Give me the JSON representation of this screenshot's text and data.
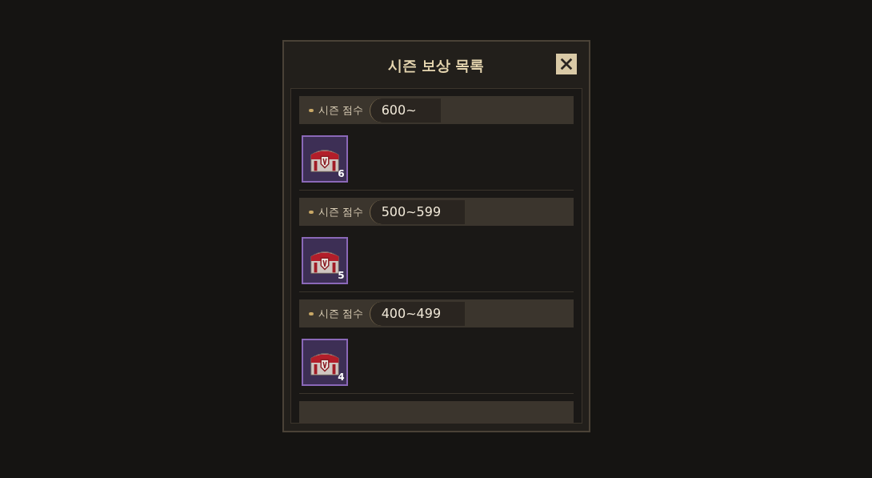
{
  "dialog": {
    "title": "시즌 보상 목록"
  },
  "tiers": [
    {
      "label": "시즌 점수",
      "range": "600~",
      "rewards": [
        {
          "count": "6"
        }
      ]
    },
    {
      "label": "시즌 점수",
      "range": "500~599",
      "rewards": [
        {
          "count": "5"
        }
      ]
    },
    {
      "label": "시즌 점수",
      "range": "400~499",
      "rewards": [
        {
          "count": "4"
        }
      ]
    }
  ]
}
